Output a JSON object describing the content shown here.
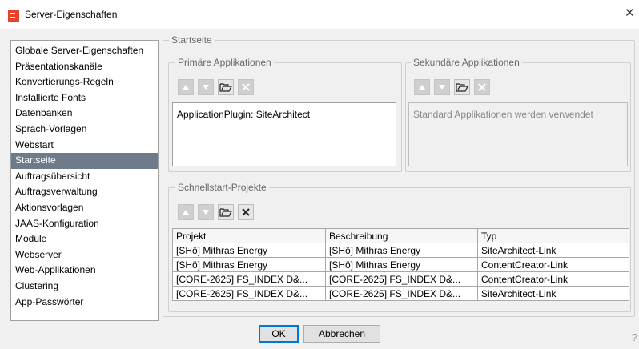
{
  "window": {
    "title": "Server-Eigenschaften",
    "close_glyph": "✕"
  },
  "sidebar": {
    "items": [
      {
        "label": "Globale Server-Eigenschaften",
        "selected": false
      },
      {
        "label": "Präsentationskanäle",
        "selected": false
      },
      {
        "label": "Konvertierungs-Regeln",
        "selected": false
      },
      {
        "label": "Installierte Fonts",
        "selected": false
      },
      {
        "label": "Datenbanken",
        "selected": false
      },
      {
        "label": "Sprach-Vorlagen",
        "selected": false
      },
      {
        "label": "Webstart",
        "selected": false
      },
      {
        "label": "Startseite",
        "selected": true
      },
      {
        "label": "Auftragsübersicht",
        "selected": false
      },
      {
        "label": "Auftragsverwaltung",
        "selected": false
      },
      {
        "label": "Aktionsvorlagen",
        "selected": false
      },
      {
        "label": "JAAS-Konfiguration",
        "selected": false
      },
      {
        "label": "Module",
        "selected": false
      },
      {
        "label": "Webserver",
        "selected": false
      },
      {
        "label": "Web-Applikationen",
        "selected": false
      },
      {
        "label": "Clustering",
        "selected": false
      },
      {
        "label": "App-Passwörter",
        "selected": false
      }
    ]
  },
  "main": {
    "group_title": "Startseite",
    "primary": {
      "title": "Primäre Applikationen",
      "items": [
        "ApplicationPlugin: SiteArchitect"
      ]
    },
    "secondary": {
      "title": "Sekundäre Applikationen",
      "placeholder": "Standard Applikationen werden verwendet"
    },
    "quickstart": {
      "title": "Schnellstart-Projekte",
      "columns": [
        "Projekt",
        "Beschreibung",
        "Typ"
      ],
      "rows": [
        [
          "[SHö] Mithras Energy",
          "[SHö] Mithras Energy",
          "SiteArchitect-Link"
        ],
        [
          "[SHö] Mithras Energy",
          "[SHö] Mithras Energy",
          "ContentCreator-Link"
        ],
        [
          "[CORE-2625] FS_INDEX D&...",
          "[CORE-2625] FS_INDEX D&...",
          "ContentCreator-Link"
        ],
        [
          "[CORE-2625] FS_INDEX D&...",
          "[CORE-2625] FS_INDEX D&...",
          "SiteArchitect-Link"
        ]
      ]
    }
  },
  "footer": {
    "ok_label": "OK",
    "cancel_label": "Abbrechen",
    "help_glyph": "?"
  },
  "colors": {
    "selection": "#6e7b8b",
    "accent_icon": "#e8412c",
    "default_button_border": "#0078d7"
  }
}
